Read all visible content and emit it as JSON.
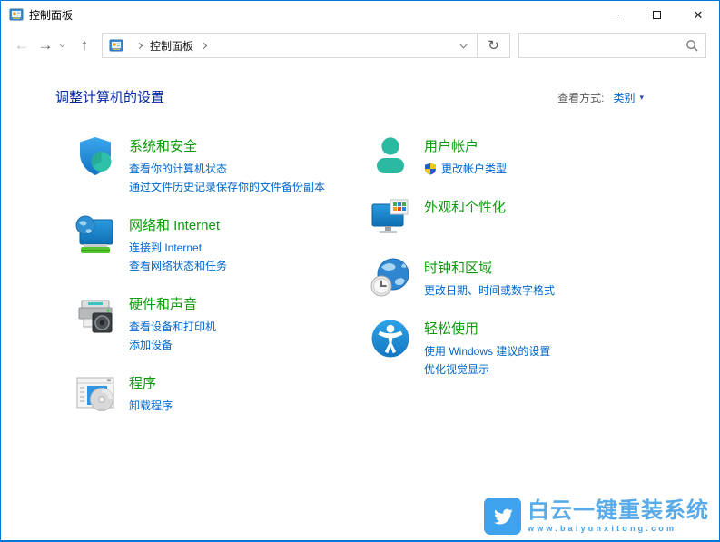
{
  "window": {
    "title": "控制面板"
  },
  "titlebar": {
    "icons": [
      "control-panel-icon",
      "minimize-icon",
      "maximize-icon",
      "close-icon"
    ]
  },
  "toolbar": {
    "icons": [
      "back-arrow-icon",
      "forward-arrow-icon",
      "recent-locations-chevron-icon",
      "up-arrow-icon",
      "address-dropdown-chevron-icon",
      "refresh-icon",
      "search-icon"
    ],
    "breadcrumb_root": "控制面板",
    "search_value": "",
    "search_placeholder": ""
  },
  "header": {
    "title": "调整计算机的设置",
    "view_by_label": "查看方式:",
    "view_by_value": "类别",
    "view_by_caret": "▾"
  },
  "categories": {
    "left": [
      {
        "icon": "security-shield-icon",
        "title": "系统和安全",
        "links": [
          {
            "text": "查看你的计算机状态"
          },
          {
            "text": "通过文件历史记录保存你的文件备份副本"
          }
        ]
      },
      {
        "icon": "network-icon",
        "title": "网络和 Internet",
        "links": [
          {
            "text": "连接到 Internet"
          },
          {
            "text": "查看网络状态和任务"
          }
        ]
      },
      {
        "icon": "hardware-sound-icon",
        "title": "硬件和声音",
        "links": [
          {
            "text": "查看设备和打印机"
          },
          {
            "text": "添加设备"
          }
        ]
      },
      {
        "icon": "programs-icon",
        "title": "程序",
        "links": [
          {
            "text": "卸载程序"
          }
        ]
      }
    ],
    "right": [
      {
        "icon": "user-accounts-icon",
        "title": "用户帐户",
        "links": [
          {
            "text": "更改帐户类型",
            "uac": true
          }
        ]
      },
      {
        "icon": "appearance-icon",
        "title": "外观和个性化",
        "links": []
      },
      {
        "icon": "clock-region-icon",
        "title": "时钟和区域",
        "links": [
          {
            "text": "更改日期、时间或数字格式"
          }
        ]
      },
      {
        "icon": "ease-of-access-icon",
        "title": "轻松使用",
        "links": [
          {
            "text": "使用 Windows 建议的设置"
          },
          {
            "text": "优化视觉显示"
          }
        ]
      }
    ]
  },
  "watermark": {
    "title": "白云一键重装系统",
    "url": "www.baiyunxitong.com",
    "icon": "bird-icon"
  },
  "colors": {
    "accent": "#0078d7",
    "category_title_green": "#0C9B0C",
    "task_link_blue": "#0066CC",
    "heading_blue": "#06289E",
    "watermark_blue": "#58AAE9"
  }
}
